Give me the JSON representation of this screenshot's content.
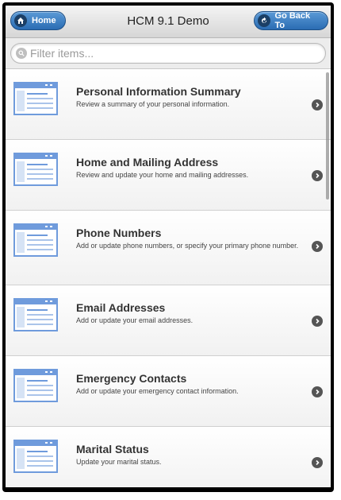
{
  "header": {
    "home_label": "Home",
    "title": "HCM 9.1 Demo",
    "back_label": "Go Back To"
  },
  "filter": {
    "placeholder": "Filter items..."
  },
  "items": [
    {
      "title": "Personal Information Summary",
      "desc": "Review a summary of your personal information."
    },
    {
      "title": "Home and Mailing Address",
      "desc": "Review and update your home and mailing addresses."
    },
    {
      "title": "Phone Numbers",
      "desc": "Add or update phone numbers, or specify your primary phone number."
    },
    {
      "title": "Email Addresses",
      "desc": "Add or update your email addresses."
    },
    {
      "title": "Emergency Contacts",
      "desc": "Add or update your emergency contact information."
    },
    {
      "title": "Marital Status",
      "desc": "Update your marital status."
    }
  ],
  "colors": {
    "accent": "#2a6cb3",
    "icon_blue": "#5b8fd8"
  }
}
